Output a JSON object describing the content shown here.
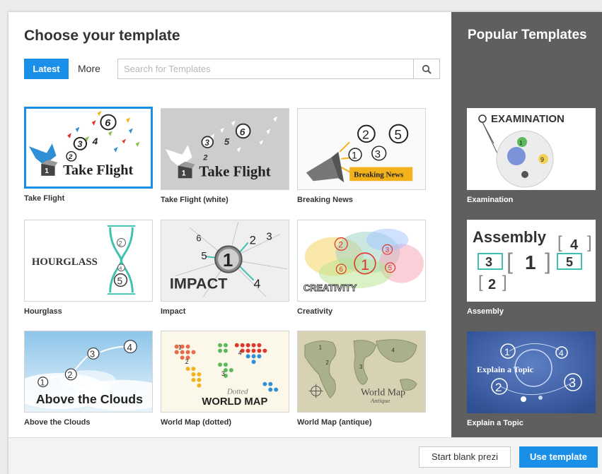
{
  "dialog": {
    "title": "Choose your template",
    "tabs": [
      {
        "label": "Latest",
        "active": true
      },
      {
        "label": "More",
        "active": false
      }
    ],
    "search": {
      "placeholder": "Search for Templates",
      "value": ""
    }
  },
  "templates": [
    {
      "label": "Take Flight",
      "selected": true
    },
    {
      "label": "Take Flight (white)"
    },
    {
      "label": "Breaking News"
    },
    {
      "label": "Hourglass"
    },
    {
      "label": "Impact"
    },
    {
      "label": "Creativity"
    },
    {
      "label": "Above the Clouds"
    },
    {
      "label": "World Map (dotted)"
    },
    {
      "label": "World Map (antique)"
    }
  ],
  "thumb_text": {
    "take_flight": "Take Flight",
    "breaking_news": "Breaking News",
    "hourglass": "HOURGLASS",
    "impact": "IMPACT",
    "creativity": "CREATIVITY",
    "above_clouds": "Above the Clouds",
    "world_map": "WORLD MAP",
    "dotted": "Dotted",
    "world_map_antique": "World Map",
    "antique": "Antique",
    "examination": "EXAMINATION",
    "assembly": "Assembly",
    "explain_topic": "Explain a Topic"
  },
  "popular": {
    "title": "Popular Templates",
    "items": [
      {
        "label": "Examination"
      },
      {
        "label": "Assembly"
      },
      {
        "label": "Explain a Topic"
      }
    ]
  },
  "footer": {
    "start_blank": "Start blank prezi",
    "use_template": "Use template"
  },
  "colors": {
    "accent": "#1a8fe8",
    "sidebar": "#5f5f5f"
  }
}
